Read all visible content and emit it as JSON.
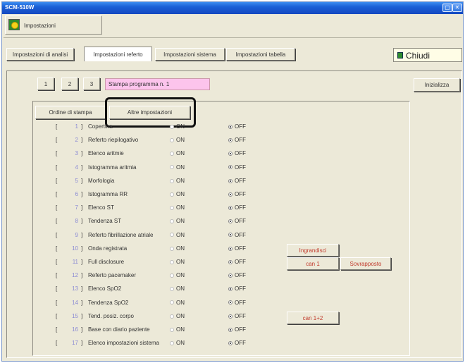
{
  "window": {
    "title": "SCM-510W",
    "icon": "window-app-icon"
  },
  "header": {
    "label": "Impostazioni",
    "icon": "settings-sun-icon"
  },
  "tabs": [
    {
      "label": "Impostazioni di analisi"
    },
    {
      "label": "Impostazioni referto",
      "active": true
    },
    {
      "label": "Impostazioni sistema"
    },
    {
      "label": "Impostazioni tabella"
    }
  ],
  "close_button": {
    "label": "Chiudi",
    "icon": "close-door-icon"
  },
  "page_buttons": [
    "1",
    "2",
    "3"
  ],
  "program_field": {
    "value": "Stampa programma n. 1"
  },
  "initialize_button": {
    "label": "Inizializza"
  },
  "subtabs": {
    "order": "Ordine di stampa",
    "other": "Altre impostazioni"
  },
  "on_label": "ON",
  "off_label": "OFF",
  "items": [
    {
      "num": "1",
      "label": "Copertina",
      "state": "OFF"
    },
    {
      "num": "2",
      "label": "Referto riepilogativo",
      "state": "OFF"
    },
    {
      "num": "3",
      "label": "Elenco aritmie",
      "state": "OFF"
    },
    {
      "num": "4",
      "label": "Istogramma aritmia",
      "state": "OFF"
    },
    {
      "num": "5",
      "label": "Morfologia",
      "state": "OFF"
    },
    {
      "num": "6",
      "label": "Istogramma RR",
      "state": "OFF"
    },
    {
      "num": "7",
      "label": "Elenco ST",
      "state": "OFF"
    },
    {
      "num": "8",
      "label": "Tendenza ST",
      "state": "OFF"
    },
    {
      "num": "9",
      "label": "Referto fibrillazione atriale",
      "state": "OFF"
    },
    {
      "num": "10",
      "label": "Onda registrata",
      "state": "OFF"
    },
    {
      "num": "11",
      "label": "Full disclosure",
      "state": "OFF"
    },
    {
      "num": "12",
      "label": "Referto pacemaker",
      "state": "OFF"
    },
    {
      "num": "13",
      "label": "Elenco SpO2",
      "state": "OFF"
    },
    {
      "num": "14",
      "label": "Tendenza SpO2",
      "state": "OFF"
    },
    {
      "num": "15",
      "label": "Tend. posiz. corpo",
      "state": "OFF"
    },
    {
      "num": "16",
      "label": "Base con diario paziente",
      "state": "OFF"
    },
    {
      "num": "17",
      "label": "Elenco impostazioni sistema",
      "state": "OFF"
    }
  ],
  "extra_buttons": {
    "ingrandisci": "Ingrandisci",
    "can1": "can 1",
    "sovrapposto": "Sovrapposto",
    "can12": "can 1+2"
  }
}
